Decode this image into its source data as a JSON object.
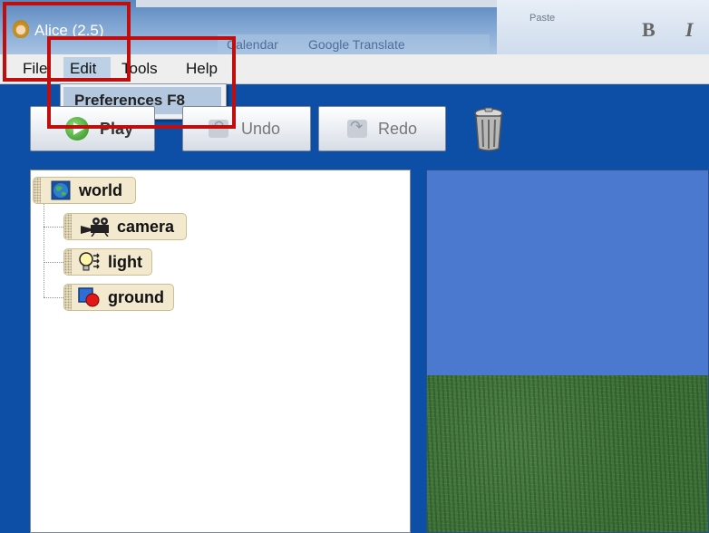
{
  "window": {
    "title": "Alice (2.5)"
  },
  "background": {
    "ribbon_paste": "Paste",
    "ribbon_bold": "B",
    "ribbon_italic": "I",
    "toolbar_item_1": "Calendar",
    "toolbar_item_2": "Google Translate"
  },
  "menubar": {
    "items": [
      {
        "label": "File"
      },
      {
        "label": "Edit"
      },
      {
        "label": "Tools"
      },
      {
        "label": "Help"
      }
    ],
    "open_menu": {
      "parent": "Edit",
      "items": [
        {
          "label": "Preferences F8"
        }
      ]
    }
  },
  "toolbar": {
    "play_label": "Play",
    "undo_label": "Undo",
    "redo_label": "Redo",
    "trash_icon": "trash-can-icon"
  },
  "object_tree": {
    "root": {
      "label": "world",
      "icon": "globe-icon"
    },
    "children": [
      {
        "label": "camera",
        "icon": "movie-camera-icon"
      },
      {
        "label": "light",
        "icon": "light-bulb-icon"
      },
      {
        "label": "ground",
        "icon": "ground-shapes-icon"
      }
    ]
  },
  "world_view": {
    "sky_color": "#4a79cf",
    "ground_color": "#3b6f35"
  },
  "highlight": {
    "color": "#c00d0d"
  }
}
